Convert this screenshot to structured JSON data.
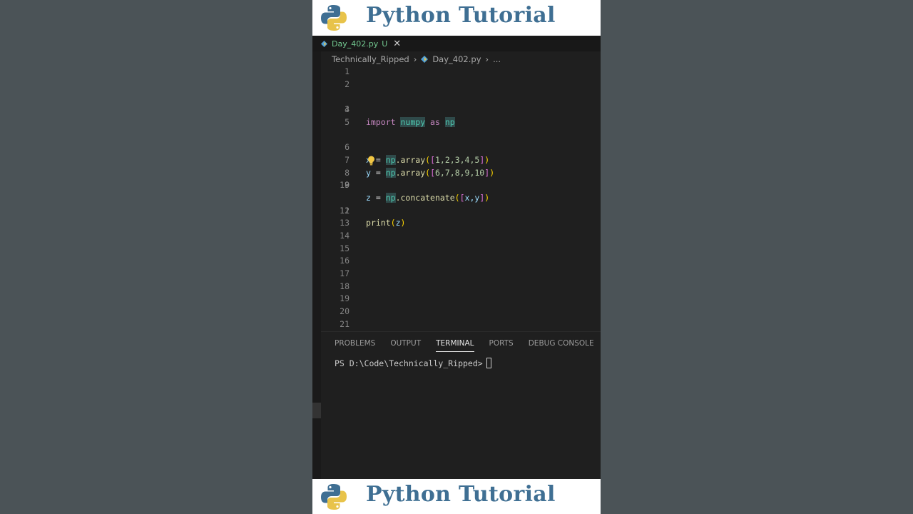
{
  "banner": {
    "title": "Python Tutorial"
  },
  "tab": {
    "filename": "Day_402.py",
    "status": "U",
    "close": "✕"
  },
  "breadcrumb": {
    "folder": "Technically_Ripped",
    "file": "Day_402.py",
    "more": "..."
  },
  "code": {
    "line_numbers": [
      "1",
      "2",
      "3",
      "4",
      "5",
      "6",
      "7",
      "8",
      "9",
      "10",
      "11",
      "12",
      "13",
      "14",
      "15",
      "16",
      "17",
      "18",
      "19",
      "20",
      "21"
    ],
    "line3": {
      "import": "import",
      "module": "numpy",
      "as": "as",
      "alias": "np"
    },
    "line6": {
      "var": "x",
      "eq": " = ",
      "alias": "np",
      "fn": ".array",
      "open": "(",
      "ob": "[",
      "nums": "1,2,3,4,5",
      "cb": "]",
      "close": ")"
    },
    "line7": {
      "var": "y",
      "eq": " = ",
      "alias": "np",
      "fn": ".array",
      "open": "(",
      "ob": "[",
      "nums": "6,7,8,9,10",
      "cb": "]",
      "close": ")"
    },
    "line9": {
      "var": "z",
      "eq": " = ",
      "alias": "np",
      "fn": ".concatenate",
      "open": "(",
      "ob": "[",
      "args": "x,y",
      "cb": "]",
      "close": ")"
    },
    "line11": {
      "fn": "print",
      "open": "(",
      "arg": "z",
      "close": ")"
    },
    "active_line": "9"
  },
  "panel": {
    "tabs": [
      "PROBLEMS",
      "OUTPUT",
      "TERMINAL",
      "PORTS",
      "DEBUG CONSOLE"
    ],
    "active_tab": "TERMINAL",
    "prompt": "PS D:\\Code\\Technically_Ripped>"
  },
  "colors": {
    "banner_title": "#3f6f93",
    "editor_bg": "#1f1f1f",
    "side_bg": "#4b5357"
  },
  "icons": {
    "logo": "python-logo-icon",
    "file": "python-file-icon",
    "bulb": "lightbulb-icon"
  }
}
